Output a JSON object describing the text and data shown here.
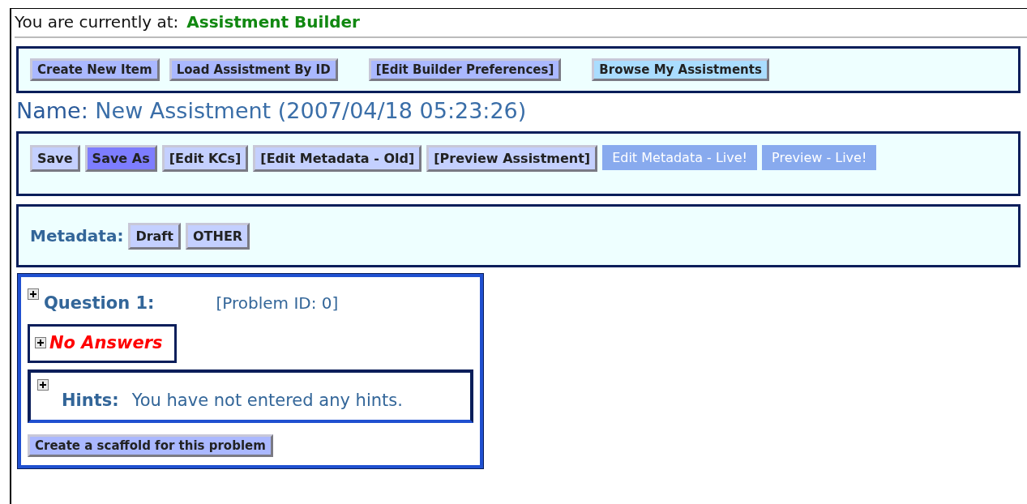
{
  "location": {
    "prefix": "You are currently at:",
    "page": "Assistment Builder"
  },
  "toolbar": [
    {
      "label": "Create New Item",
      "kind": "standard"
    },
    {
      "label": "Load Assistment By ID",
      "kind": "standard"
    },
    {
      "label": "[Edit Builder Preferences]",
      "kind": "standard"
    },
    {
      "label": "Browse My Assistments",
      "kind": "alt"
    }
  ],
  "name": {
    "label": "Name:",
    "value": "New Assistment (2007/04/18 05:23:26)"
  },
  "actions": [
    {
      "label": "Save",
      "kind": "light"
    },
    {
      "label": "Save As",
      "kind": "active"
    },
    {
      "label": "[Edit KCs]",
      "kind": "light"
    },
    {
      "label": "[Edit Metadata - Old]",
      "kind": "light"
    },
    {
      "label": "[Preview Assistment]",
      "kind": "light"
    },
    {
      "label": "Edit Metadata - Live!",
      "kind": "live"
    },
    {
      "label": "Preview - Live!",
      "kind": "live"
    }
  ],
  "metadata": {
    "label": "Metadata:",
    "tags": [
      {
        "label": "Draft"
      },
      {
        "label": "OTHER"
      }
    ]
  },
  "question": {
    "title": "Question 1:",
    "problem_id": "[Problem ID: 0]",
    "expanded": false,
    "answers": {
      "label": "No Answers",
      "expanded": false
    },
    "hints": {
      "label": "Hints:",
      "text": "You have not entered any hints.",
      "expanded": false
    },
    "scaffold_button": "Create a scaffold for this problem"
  }
}
